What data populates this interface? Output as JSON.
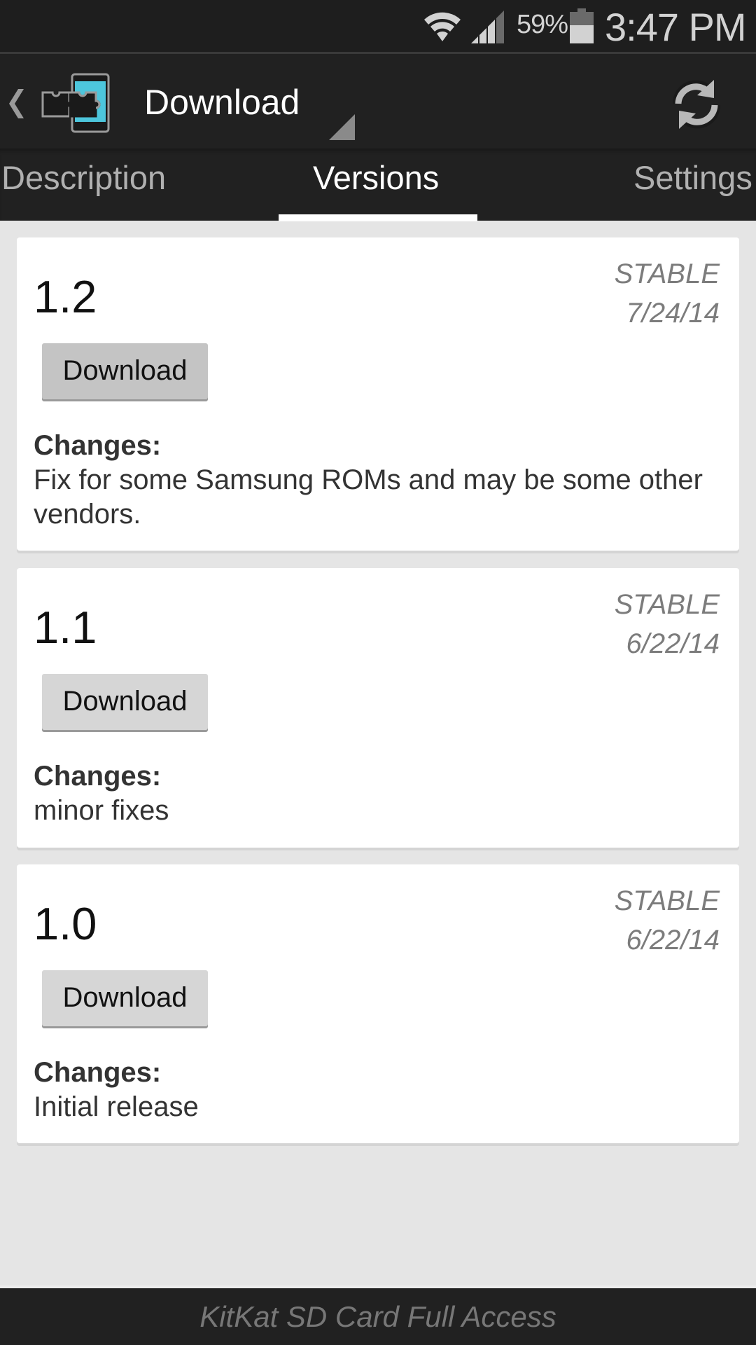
{
  "status_bar": {
    "battery_percent": "59%",
    "battery_level": 0.59,
    "signal_bars": 3,
    "signal_max": 4,
    "time": "3:47 PM",
    "icons": [
      "wifi-icon",
      "signal-icon",
      "battery-icon"
    ]
  },
  "action_bar": {
    "title": "Download",
    "icons": [
      "back-chevron-icon",
      "app-puzzle-phone-icon",
      "dropdown-triangle-icon",
      "refresh-icon"
    ],
    "accent": "#4dc6dc"
  },
  "tabs": [
    {
      "label": "Description",
      "selected": false
    },
    {
      "label": "Versions",
      "selected": true
    },
    {
      "label": "Settings",
      "selected": false
    }
  ],
  "versions": [
    {
      "version": "1.2",
      "channel": "STABLE",
      "date": "7/24/14",
      "button": "Download",
      "changes_label": "Changes:",
      "changes": "Fix for some Samsung ROMs and may be some other vendors."
    },
    {
      "version": "1.1",
      "channel": "STABLE",
      "date": "6/22/14",
      "button": "Download",
      "changes_label": "Changes:",
      "changes": "minor fixes"
    },
    {
      "version": "1.0",
      "channel": "STABLE",
      "date": "6/22/14",
      "button": "Download",
      "changes_label": "Changes:",
      "changes": "Initial release"
    }
  ],
  "footer": {
    "text": "KitKat SD Card Full Access"
  }
}
